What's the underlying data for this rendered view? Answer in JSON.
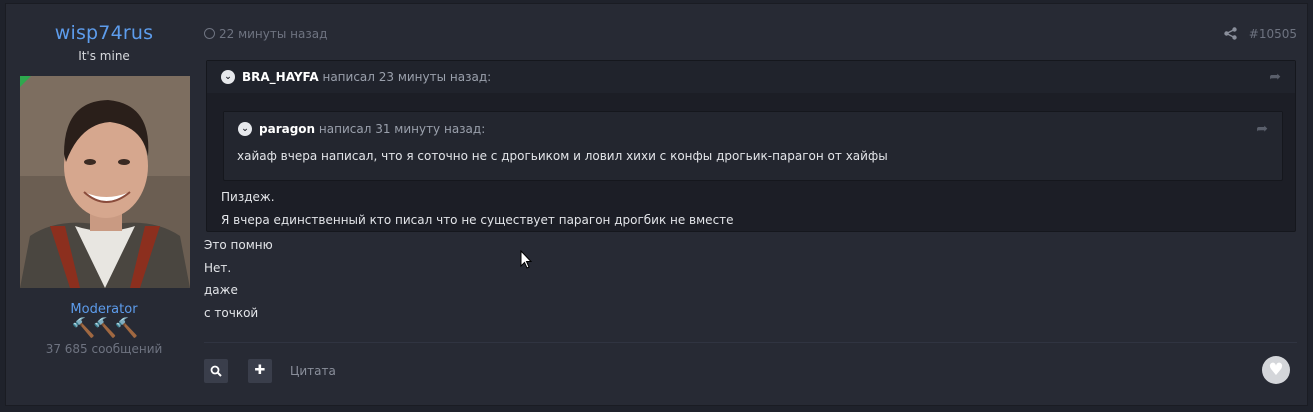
{
  "author": {
    "username": "wisp74rus",
    "title": "It's mine",
    "role": "Moderator",
    "badges": "🔨🔨🔨",
    "message_count": "37 685 сообщений"
  },
  "post": {
    "time": "22 минуты назад",
    "number": "#10505",
    "quote_outer": {
      "author": "BRA_HAYFA",
      "meta": " написал 23 минуты назад:",
      "lines": [
        "Пиздеж.",
        "Я вчера единственный кто писал что не существует парагон дрогбик не вместе"
      ]
    },
    "quote_inner": {
      "author": "paragon",
      "meta": " написал 31 минуту назад:",
      "text": "хайаф вчера написал, что я соточно не с дрогьиком и ловил хихи с конфы дрогьик-парагон от хайфы"
    },
    "body_lines": [
      "Это помню",
      "Нет.",
      "даже",
      "с точкой"
    ]
  },
  "actions": {
    "search_icon": "search-icon",
    "plus_icon": "plus-icon",
    "quote_label": "Цитата",
    "like_icon": "heart-icon"
  }
}
